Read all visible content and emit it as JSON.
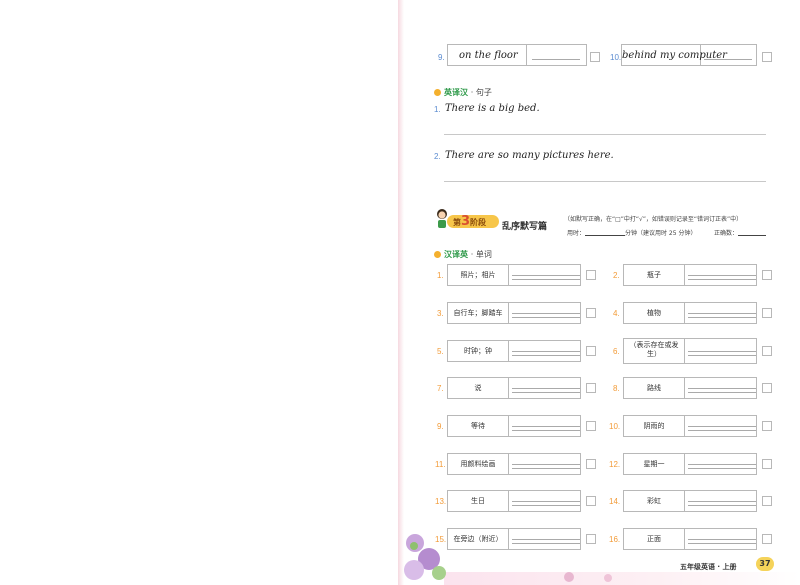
{
  "top_items": [
    {
      "num": "9.",
      "text": "on the floor"
    },
    {
      "num": "10.",
      "text": "behind my computer"
    }
  ],
  "sentences_section": {
    "title": "英译汉",
    "sub": "· 句子",
    "items": [
      {
        "num": "1.",
        "text": "There is a big bed."
      },
      {
        "num": "2.",
        "text": "There are so many pictures here."
      }
    ]
  },
  "stage": {
    "badge_prefix": "第",
    "badge_number": "3",
    "badge_suffix": "阶段",
    "name": "乱序默写篇",
    "note1": "（如默写正确，在“□”中打“√”，如错误则记录至“错词订正表”中）",
    "time_label": "用时：",
    "time_suffix": "分钟（建议用时 25 分钟）",
    "correct_label": "正确数："
  },
  "words_section": {
    "title": "汉译英",
    "sub": "· 单词",
    "items": [
      {
        "num": "1.",
        "text": "照片；相片"
      },
      {
        "num": "2.",
        "text": "瓶子"
      },
      {
        "num": "3.",
        "text": "自行车；脚踏车"
      },
      {
        "num": "4.",
        "text": "植物"
      },
      {
        "num": "5.",
        "text": "时钟；钟"
      },
      {
        "num": "6.",
        "text": "（表示存在或发生）"
      },
      {
        "num": "7.",
        "text": "说"
      },
      {
        "num": "8.",
        "text": "路线"
      },
      {
        "num": "9.",
        "text": "等待"
      },
      {
        "num": "10.",
        "text": "阴雨的"
      },
      {
        "num": "11.",
        "text": "用颜料绘画"
      },
      {
        "num": "12.",
        "text": "星期一"
      },
      {
        "num": "13.",
        "text": "生日"
      },
      {
        "num": "14.",
        "text": "彩虹"
      },
      {
        "num": "15.",
        "text": "在旁边（附近）"
      },
      {
        "num": "16.",
        "text": "正面"
      }
    ]
  },
  "footer": {
    "book": "五年级英语 · 上册",
    "page": "37"
  }
}
